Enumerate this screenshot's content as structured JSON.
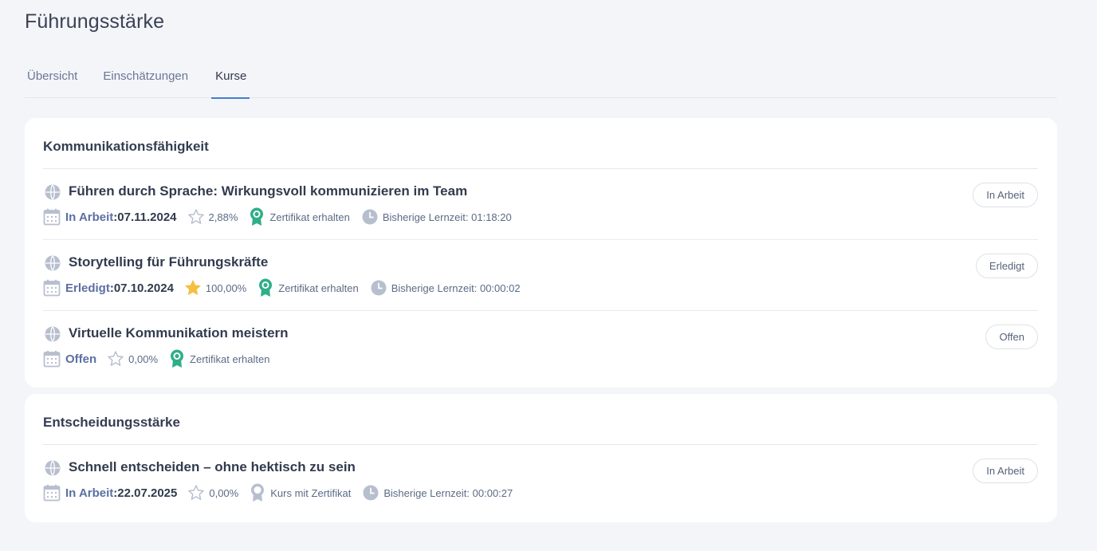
{
  "page": {
    "title": "Führungsstärke"
  },
  "tabs": [
    {
      "label": "Übersicht",
      "active": false
    },
    {
      "label": "Einschätzungen",
      "active": false
    },
    {
      "label": "Kurse",
      "active": true
    }
  ],
  "sections": [
    {
      "title": "Kommunikationsfähigkeit",
      "courses": [
        {
          "name": "Führen durch Sprache: Wirkungsvoll kommunizieren im Team",
          "status": "In Arbeit",
          "date_sep": ": ",
          "date": "07.11.2024",
          "progress": "2,88%",
          "star_filled": false,
          "certificate": "Zertifikat erhalten",
          "certificate_earned": true,
          "learning_time": "Bisherige Lernzeit: 01:18:20",
          "button": "In Arbeit"
        },
        {
          "name": "Storytelling für Führungskräfte",
          "status": "Erledigt",
          "date_sep": ": ",
          "date": "07.10.2024",
          "progress": "100,00%",
          "star_filled": true,
          "certificate": "Zertifikat erhalten",
          "certificate_earned": true,
          "learning_time": "Bisherige Lernzeit: 00:00:02",
          "button": "Erledigt"
        },
        {
          "name": "Virtuelle Kommunikation meistern",
          "status": "Offen",
          "date_sep": "",
          "date": "",
          "progress": "0,00%",
          "star_filled": false,
          "certificate": "Zertifikat erhalten",
          "certificate_earned": true,
          "learning_time": "",
          "button": "Offen"
        }
      ]
    },
    {
      "title": "Entscheidungsstärke",
      "courses": [
        {
          "name": "Schnell entscheiden – ohne hektisch zu sein",
          "status": "In Arbeit",
          "date_sep": ": ",
          "date": "22.07.2025",
          "progress": "0,00%",
          "star_filled": false,
          "certificate": "Kurs mit Zertifikat",
          "certificate_earned": false,
          "learning_time": "Bisherige Lernzeit: 00:00:27",
          "button": "In Arbeit"
        }
      ]
    }
  ],
  "colors": {
    "accent": "#3f7fd0",
    "status_text": "#5b6fa3",
    "certificate_green": "#2fae87",
    "star_gold": "#f5bf42",
    "icon_gray": "#b7bfcf"
  },
  "icons": {
    "course": "globe-icon",
    "date": "calendar-icon",
    "progress": "star-icon",
    "certificate": "award-icon",
    "time": "clock-icon"
  }
}
